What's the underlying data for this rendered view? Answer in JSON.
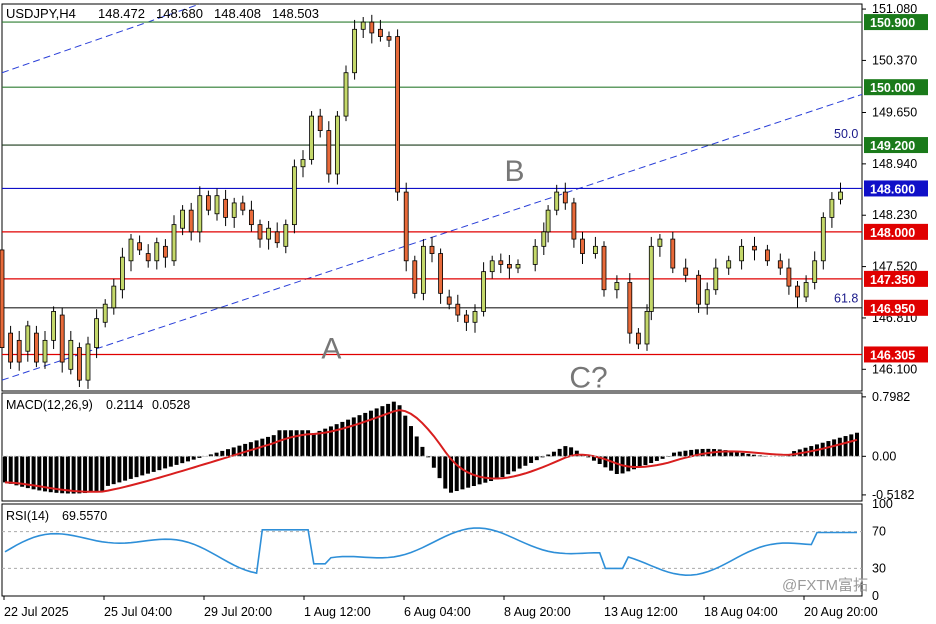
{
  "header": {
    "symbol_label": "USDJPY,H4",
    "ohlc": [
      "148.472",
      "148.680",
      "148.408",
      "148.503"
    ]
  },
  "chart_data": [
    {
      "type": "candlestick",
      "title": "USDJPY,H4",
      "ylim": [
        145.8,
        151.15
      ],
      "y_ticks": [
        "151.080",
        "150.370",
        "149.650",
        "148.940",
        "148.230",
        "147.520",
        "146.810",
        "146.100"
      ],
      "x_tick_labels": [
        "22 Jul 2025",
        "25 Jul 04:00",
        "29 Jul 20:00",
        "1 Aug 12:00",
        "6 Aug 04:00",
        "8 Aug 20:00",
        "13 Aug 12:00",
        "18 Aug 04:00",
        "20 Aug 20:00"
      ],
      "levels": [
        {
          "label": "150.900",
          "value": 150.9,
          "color": "#1a7a1a",
          "line": "#2e7d32"
        },
        {
          "label": "150.000",
          "value": 150.0,
          "color": "#1a7a1a",
          "line": "#2e7d32"
        },
        {
          "label": "149.200",
          "value": 149.2,
          "color": "#1a7a1a",
          "line": "#1b3b1b"
        },
        {
          "label": "148.600",
          "value": 148.6,
          "color": "#1010c8",
          "line": "#1010c8"
        },
        {
          "label": "148.000",
          "value": 148.0,
          "color": "#e00000",
          "line": "#e00000"
        },
        {
          "label": "147.350",
          "value": 147.35,
          "color": "#e00000",
          "line": "#e00000"
        },
        {
          "label": "146.950",
          "value": 146.95,
          "color": "#e00000",
          "line": "#202020"
        },
        {
          "label": "146.305",
          "value": 146.305,
          "color": "#e00000",
          "line": "#e00000"
        }
      ],
      "fib_labels": [
        {
          "text": "50.0",
          "value": 149.35
        },
        {
          "text": "61.8",
          "value": 147.08
        }
      ],
      "wave_labels": [
        {
          "text": "A",
          "x": 0.383,
          "value": 146.25
        },
        {
          "text": "B",
          "x": 0.596,
          "value": 148.7
        },
        {
          "text": "C?",
          "x": 0.682,
          "value": 145.85
        }
      ],
      "channel": {
        "lower": [
          [
            0.0,
            145.95
          ],
          [
            1.0,
            149.9
          ]
        ],
        "upper": [
          [
            0.0,
            150.2
          ],
          [
            0.23,
            151.15
          ]
        ]
      },
      "candles": [
        [
          0.0,
          147.75,
          146.4
        ],
        [
          0.01,
          146.6,
          146.2
        ],
        [
          0.02,
          146.5,
          146.2
        ],
        [
          0.03,
          146.35,
          146.7
        ],
        [
          0.04,
          146.6,
          146.2
        ],
        [
          0.05,
          146.2,
          146.5
        ],
        [
          0.06,
          146.5,
          146.9
        ],
        [
          0.07,
          146.85,
          146.2
        ],
        [
          0.08,
          146.1,
          146.5
        ],
        [
          0.09,
          146.4,
          145.95
        ],
        [
          0.1,
          145.95,
          146.45
        ],
        [
          0.11,
          146.4,
          146.8
        ],
        [
          0.12,
          146.75,
          147.0
        ],
        [
          0.13,
          146.95,
          147.25
        ],
        [
          0.14,
          147.2,
          147.65
        ],
        [
          0.15,
          147.6,
          147.9
        ],
        [
          0.16,
          147.85,
          147.75
        ],
        [
          0.17,
          147.7,
          147.6
        ],
        [
          0.18,
          147.6,
          147.85
        ],
        [
          0.19,
          147.8,
          147.65
        ],
        [
          0.2,
          147.6,
          148.1
        ],
        [
          0.21,
          148.05,
          148.3
        ],
        [
          0.22,
          148.3,
          148.0
        ],
        [
          0.23,
          148.0,
          148.5
        ],
        [
          0.24,
          148.5,
          148.3
        ],
        [
          0.25,
          148.25,
          148.5
        ],
        [
          0.26,
          148.45,
          148.2
        ],
        [
          0.27,
          148.2,
          148.4
        ],
        [
          0.28,
          148.4,
          148.3
        ],
        [
          0.29,
          148.3,
          148.1
        ],
        [
          0.3,
          148.1,
          147.9
        ],
        [
          0.31,
          147.9,
          148.05
        ],
        [
          0.32,
          148.0,
          147.85
        ],
        [
          0.33,
          147.8,
          148.1
        ],
        [
          0.34,
          148.1,
          148.9
        ],
        [
          0.35,
          148.9,
          149.0
        ],
        [
          0.36,
          149.0,
          149.6
        ],
        [
          0.37,
          149.6,
          149.4
        ],
        [
          0.38,
          149.4,
          148.8
        ],
        [
          0.39,
          148.8,
          149.6
        ],
        [
          0.4,
          149.6,
          150.2
        ],
        [
          0.41,
          150.2,
          150.8
        ],
        [
          0.42,
          150.8,
          150.9
        ],
        [
          0.43,
          150.9,
          150.75
        ],
        [
          0.44,
          150.8,
          150.7
        ],
        [
          0.45,
          150.7,
          150.65
        ],
        [
          0.46,
          150.7,
          148.55
        ],
        [
          0.47,
          148.55,
          147.6
        ],
        [
          0.48,
          147.6,
          147.15
        ],
        [
          0.49,
          147.15,
          147.8
        ],
        [
          0.5,
          147.8,
          147.7
        ],
        [
          0.51,
          147.7,
          147.15
        ],
        [
          0.52,
          147.1,
          147.0
        ],
        [
          0.53,
          147.0,
          146.85
        ],
        [
          0.54,
          146.85,
          146.75
        ],
        [
          0.55,
          146.75,
          146.9
        ],
        [
          0.56,
          146.9,
          147.45
        ],
        [
          0.57,
          147.45,
          147.6
        ],
        [
          0.58,
          147.6,
          147.55
        ],
        [
          0.59,
          147.55,
          147.5
        ]
      ]
    },
    {
      "type": "bar",
      "title": "MACD(12,26,9)",
      "series": [
        {
          "name": "MACD",
          "value": "0.2114"
        },
        {
          "name": "Signal",
          "value": "0.0528"
        }
      ],
      "y_ticks": [
        "0.7982",
        "0.00",
        "-0.5182"
      ],
      "ylim": [
        -0.6,
        0.85
      ]
    },
    {
      "type": "line",
      "title": "RSI(14)",
      "series": [
        {
          "name": "RSI",
          "value": "69.5570"
        }
      ],
      "y_ticks": [
        "100",
        "70",
        "30",
        "0"
      ],
      "ylim": [
        0,
        100
      ]
    }
  ],
  "watermark": "@FXTM富拓",
  "colors": {
    "bull_fill": "#c4d86a",
    "bear_fill": "#e86a3a",
    "candle_outline": "#000000",
    "macd_hist": "#000000",
    "signal_line": "#d81e1e",
    "rsi_line": "#2e8fd8",
    "channel": "#2a3fd8",
    "axis_text": "#000000",
    "wave_text": "#777777",
    "fib_text": "#1a1a8a"
  }
}
